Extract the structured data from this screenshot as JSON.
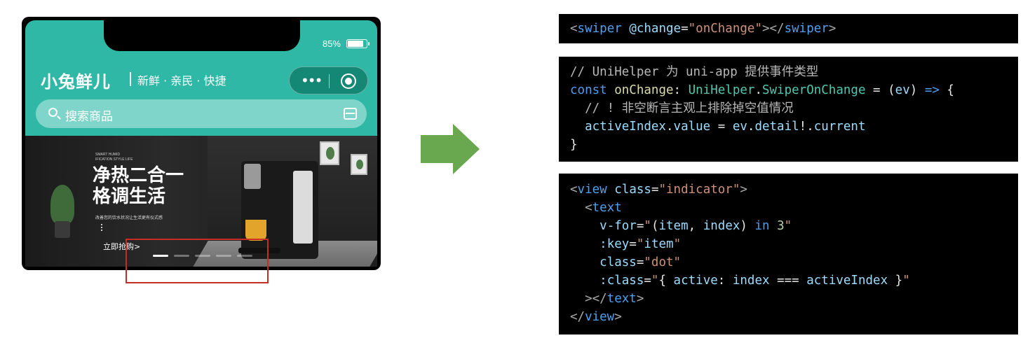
{
  "phone": {
    "battery": "85%",
    "brand": "小兔鲜儿",
    "slogan": "新鲜 · 亲民 · 快捷",
    "search_placeholder": "搜索商品",
    "banner": {
      "tiny_text": "SMART HUMID\nIFICATION STYLE LIFE",
      "headline": "净热二合一\n格调生活",
      "subline": "改善您的饮水状况让生活更有仪式感",
      "cta": "立即抢购>",
      "dot_count": 5,
      "active_dot": 0
    }
  },
  "code": {
    "block1": [
      "<swiper @change=\"onChange\"></swiper>"
    ],
    "block2": [
      "// UniHelper 为 uni-app 提供事件类型",
      "const onChange: UniHelper.SwiperOnChange = (ev) => {",
      "  // ! 非空断言主观上排除掉空值情况",
      "  activeIndex.value = ev.detail!.current",
      "}"
    ],
    "block3": [
      "<view class=\"indicator\">",
      "  <text",
      "    v-for=\"(item, index) in 3\"",
      "    :key=\"item\"",
      "    class=\"dot\"",
      "    :class=\"{ active: index === activeIndex }\"",
      "  ></text>",
      "</view>"
    ]
  },
  "colors": {
    "brand_teal": "#2fb8a6",
    "arrow_green": "#6aa84f",
    "highlight_red": "#c62d24"
  }
}
